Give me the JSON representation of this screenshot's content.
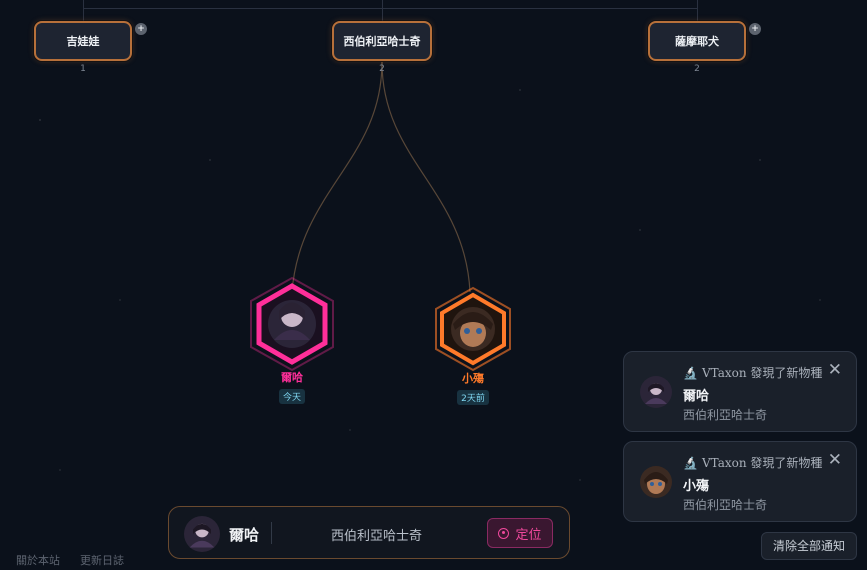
{
  "tree": {
    "taxa": [
      {
        "id": "a",
        "name": "吉娃娃",
        "count": "1",
        "has_plus": true
      },
      {
        "id": "b",
        "name": "西伯利亞哈士奇",
        "count": "2",
        "has_plus": false
      },
      {
        "id": "c",
        "name": "薩摩耶犬",
        "count": "2",
        "has_plus": true
      }
    ],
    "plus_symbol": "+",
    "species": [
      {
        "name": "爾哈",
        "date": "今天",
        "color": "#ff2f9a"
      },
      {
        "name": "小殤",
        "date": "2天前",
        "color": "#ff7a2a"
      }
    ]
  },
  "notifications": [
    {
      "header": "VTaxon 發現了新物種",
      "name": "爾哈",
      "genus": "西伯利亞哈士奇"
    },
    {
      "header": "VTaxon 發現了新物種",
      "name": "小殤",
      "genus": "西伯利亞哈士奇"
    }
  ],
  "close_symbol": "✕",
  "clear_all_label": "清除全部通知",
  "bottom_bar": {
    "name": "爾哈",
    "genus": "西伯利亞哈士奇",
    "locate_label": "定位"
  },
  "footer": {
    "about": "關於本站",
    "changelog": "更新日誌"
  }
}
